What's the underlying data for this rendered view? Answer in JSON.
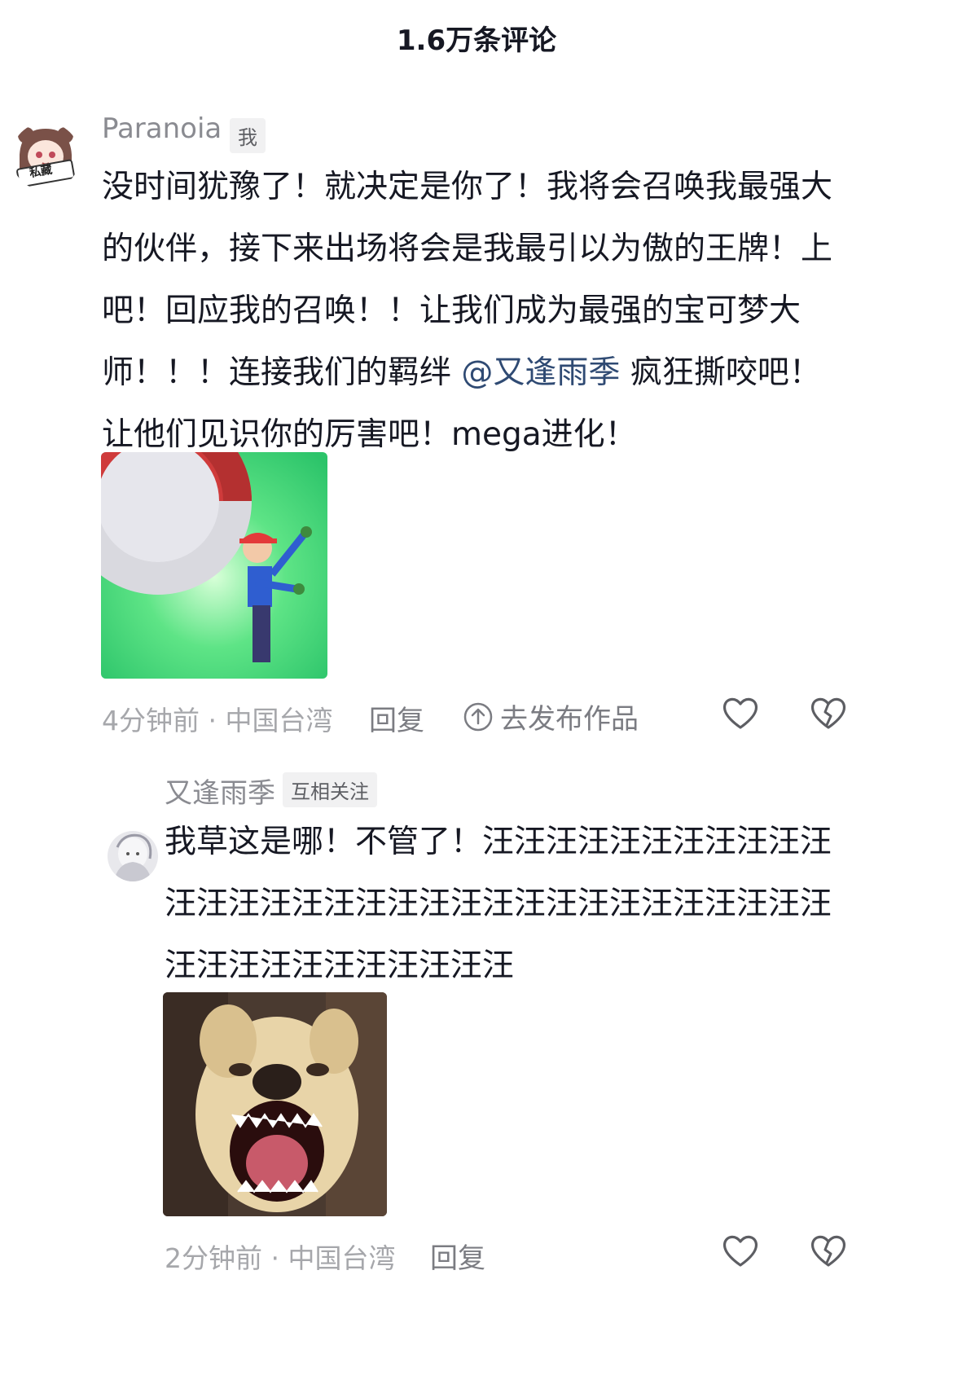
{
  "header": {
    "title": "1.6万条评论"
  },
  "comment": {
    "username": "Paranoia",
    "tag": "我",
    "avatar_badge": "私藏",
    "text_before_mention": "没时间犹豫了！就决定是你了！我将会召唤我最强大的伙伴，接下来出场将会是我最引以为傲的王牌！上吧！回应我的召唤！！让我们成为最强的宝可梦大师！！！连接我们的羁绊 ",
    "mention": "@又逢雨季",
    "text_after_mention": " 疯狂撕咬吧！让他们见识你的厉害吧！mega进化！",
    "time_location": "4分钟前 · 中国台湾",
    "reply_label": "回复",
    "publish_label": "去发布作品",
    "icons": {
      "publish": "upload-circle-icon",
      "like": "heart-outline-icon",
      "dislike": "broken-heart-icon"
    }
  },
  "reply": {
    "username": "又逢雨季",
    "tag": "互相关注",
    "text": "我草这是哪！不管了！汪汪汪汪汪汪汪汪汪汪汪汪汪汪汪汪汪汪汪汪汪汪汪汪汪汪汪汪汪汪汪汪汪汪汪汪汪汪汪汪汪汪汪",
    "time_location": "2分钟前 · 中国台湾",
    "reply_label": "回复",
    "icons": {
      "like": "heart-outline-icon",
      "dislike": "broken-heart-icon"
    }
  },
  "colors": {
    "primary_text": "#161823",
    "secondary_text": "#8a8b91",
    "mention": "#2f4a73",
    "meta_text": "#a6a7ab"
  }
}
